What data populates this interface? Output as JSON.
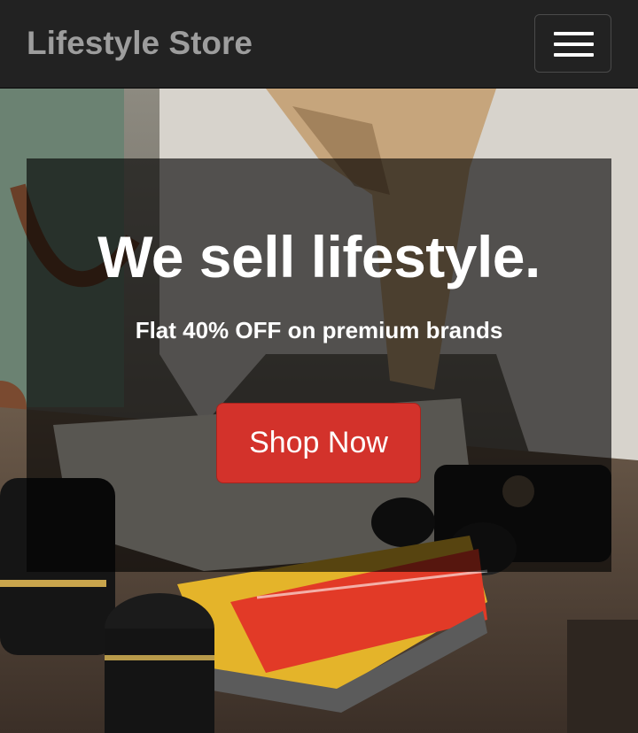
{
  "navbar": {
    "brand": "Lifestyle Store",
    "menu_icon": "hamburger-menu-icon"
  },
  "hero": {
    "headline": "We sell lifestyle.",
    "subline": "Flat 40% OFF on premium brands",
    "cta_label": "Shop Now"
  },
  "colors": {
    "navbar_bg": "#222222",
    "brand_text": "#9d9d9d",
    "cta_bg": "#d3322b",
    "panel_overlay": "rgba(0,0,0,0.62)"
  }
}
